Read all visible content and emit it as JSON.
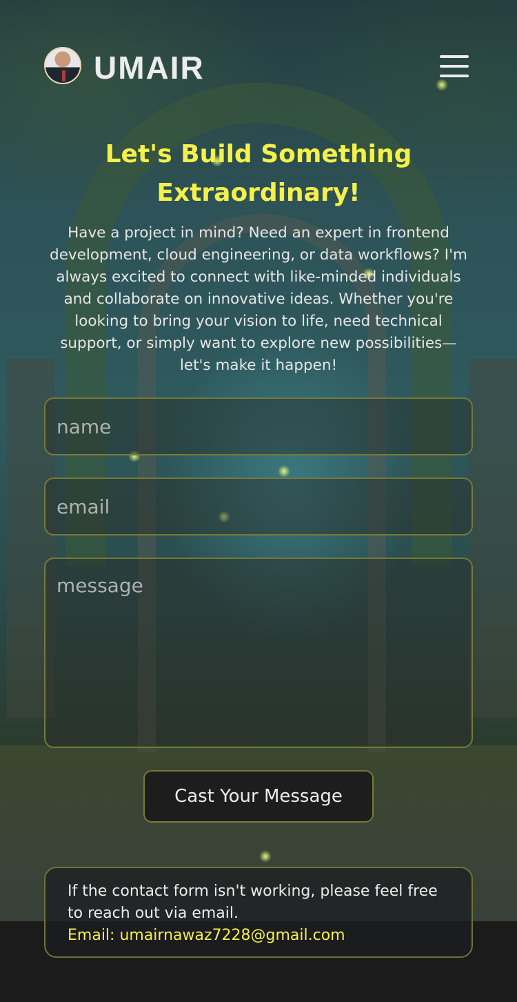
{
  "header": {
    "brand": "UMAIR",
    "avatar_alt": "Umair profile photo"
  },
  "hero": {
    "title": "Let's Build Something Extraordinary!",
    "description": "Have a project in mind? Need an expert in frontend development, cloud engineering, or data workflows? I'm always excited to connect with like-minded individuals and collaborate on innovative ideas. Whether you're looking to bring your vision to life, need technical support, or simply want to explore new possibilities—let's make it happen!"
  },
  "form": {
    "name_placeholder": "name",
    "email_placeholder": "email",
    "message_placeholder": "message",
    "submit_label": "Cast Your Message"
  },
  "fallback": {
    "message": "If the contact form isn't working, please feel free to reach out via email.",
    "email_text": "Email: umairnawaz7228@gmail.com"
  },
  "colors": {
    "accent": "#f5f04a",
    "border": "#757a39",
    "text": "#ececec",
    "footer_bg": "#1b1b1b"
  }
}
